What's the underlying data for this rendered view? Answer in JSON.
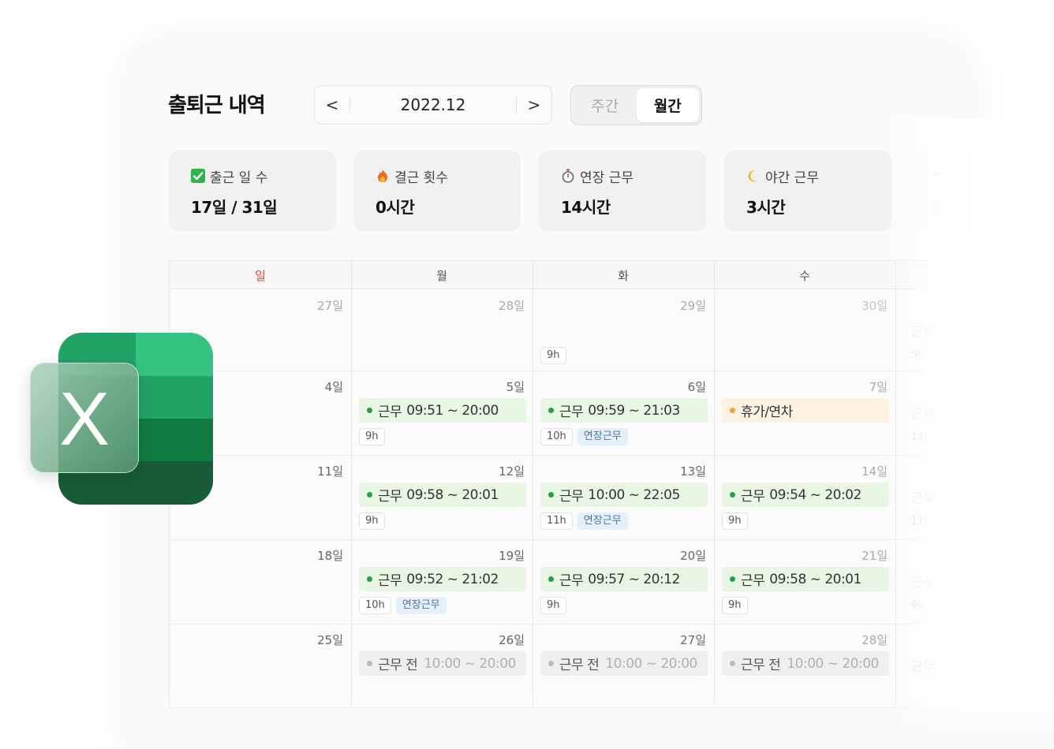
{
  "header": {
    "title": "출퇴근 내역",
    "prev_label": "<",
    "next_label": ">",
    "date": "2022.12",
    "view_week": "주간",
    "view_month": "월간"
  },
  "stats": [
    {
      "icon": "check-box-icon",
      "label": "출근 일 수",
      "value": "17일 / 31일"
    },
    {
      "icon": "fire-icon",
      "label": "결근 횟수",
      "value": "0시간"
    },
    {
      "icon": "stopwatch-icon",
      "label": "연장 근무",
      "value": "14시간"
    },
    {
      "icon": "moon-icon",
      "label": "야간 근무",
      "value": "3시간"
    },
    {
      "icon": "umbrella-icon",
      "label": "",
      "value": "2회"
    }
  ],
  "calendar": {
    "weekdays": [
      "일",
      "월",
      "화",
      "수"
    ],
    "weeks": [
      [
        "27일",
        "28일",
        "29일",
        "30일"
      ],
      [
        "4일",
        "5일",
        "6일",
        "7일"
      ],
      [
        "11일",
        "12일",
        "13일",
        "14일"
      ],
      [
        "18일",
        "19일",
        "20일",
        "21일"
      ],
      [
        "25일",
        "26일",
        "27일",
        "28일"
      ]
    ],
    "events": {
      "w1_tue_tag": "9h",
      "w2_mon": {
        "label": "근무",
        "time": "09:51 ~ 20:00",
        "tag": "9h"
      },
      "w2_tue": {
        "label": "근무",
        "time": "09:59 ~ 21:03",
        "tag": "10h",
        "badge": "연장근무"
      },
      "w2_wed": {
        "label": "휴가/연차"
      },
      "w3_mon": {
        "label": "근무",
        "time": "09:58 ~ 20:01",
        "tag": "9h"
      },
      "w3_tue": {
        "label": "근무",
        "time": "10:00 ~ 22:05",
        "tag": "11h",
        "badge": "연장근무"
      },
      "w3_wed": {
        "label": "근무",
        "time": "09:54 ~ 20:02",
        "tag": "9h"
      },
      "w4_mon": {
        "label": "근무",
        "time": "09:52 ~ 21:02",
        "tag": "10h",
        "badge": "연장근무"
      },
      "w4_tue": {
        "label": "근무",
        "time": "09:57 ~ 20:12",
        "tag": "9h"
      },
      "w4_wed": {
        "label": "근무",
        "time": "09:58 ~ 20:01",
        "tag": "9h"
      },
      "w5_mon": {
        "label": "근무 전",
        "time": "10:00 ~ 20:00"
      },
      "w5_tue": {
        "label": "근무 전",
        "time": "10:00 ~ 20:00"
      },
      "w5_wed": {
        "label": "근무 전",
        "time": "10:00 ~ 20:00"
      }
    },
    "ghost_column": {
      "w1": "근무",
      "w1_tag": "9h",
      "w2": "근무",
      "w2_tag": "11h",
      "w3": "근무",
      "w3_tag": "11h",
      "w4": "근무",
      "w4_tag": "9h",
      "w5": "근무"
    }
  },
  "logo": {
    "icon": "excel-logo-icon",
    "letter": "X"
  },
  "colors": {
    "work": "#24a148",
    "vacation": "#f4a232",
    "sunday": "#e04a3a",
    "excel_green": "#1e7a46"
  }
}
